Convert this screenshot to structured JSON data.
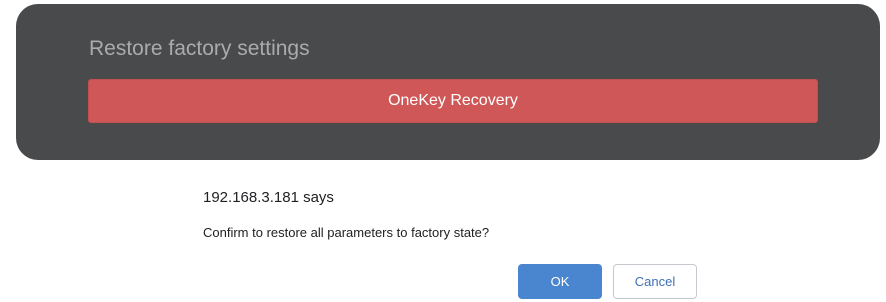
{
  "panel": {
    "title": "Restore factory settings",
    "recovery_button_label": "OneKey Recovery"
  },
  "dialog": {
    "origin": "192.168.3.181 says",
    "message": "Confirm to restore all parameters to factory state?",
    "ok_label": "OK",
    "cancel_label": "Cancel"
  },
  "colors": {
    "panel_background": "#494a4b",
    "recovery_button": "#d05757",
    "ok_button": "#4a85cf",
    "cancel_text": "#3f6fb5"
  }
}
